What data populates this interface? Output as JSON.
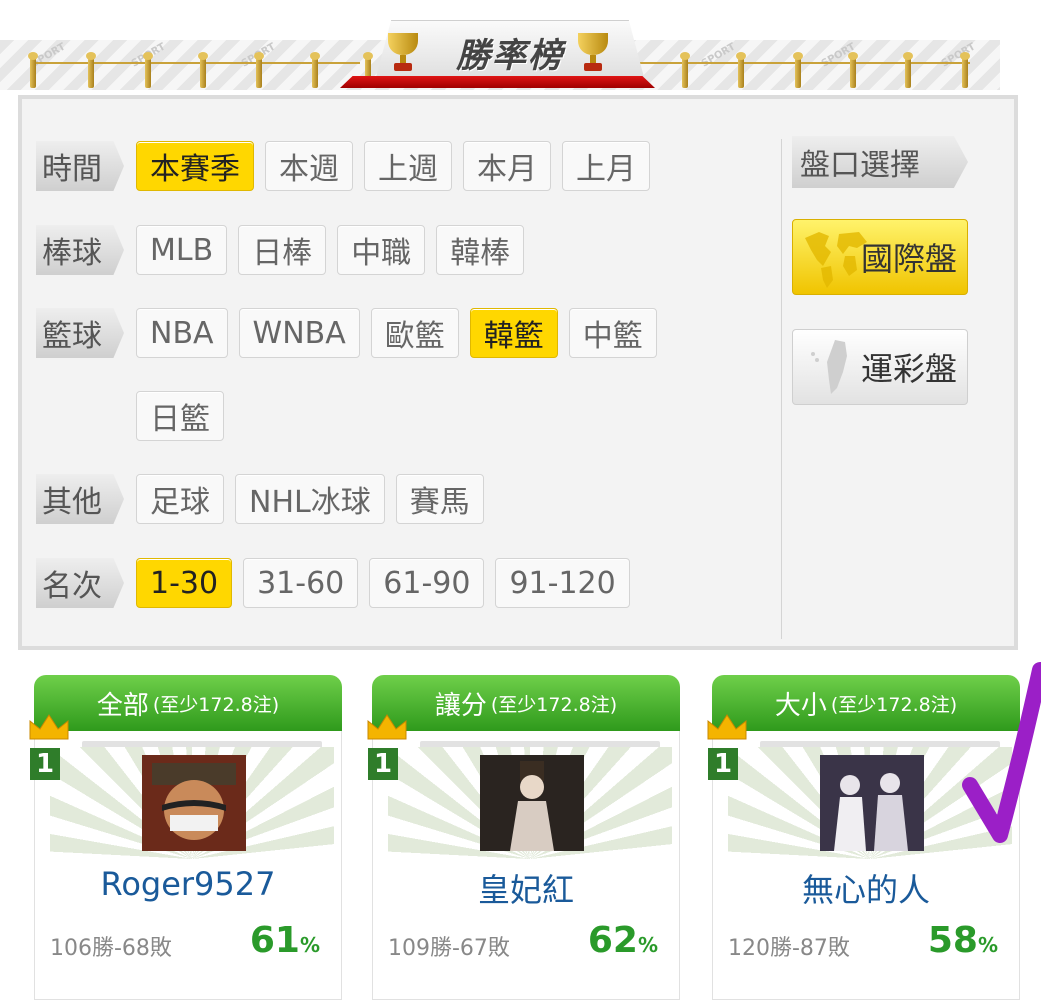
{
  "banner": {
    "title": "勝率榜",
    "watermark": "SPORT"
  },
  "filters": {
    "rows": [
      {
        "label": "時間",
        "options": [
          {
            "text": "本賽季",
            "active": true
          },
          {
            "text": "本週",
            "active": false
          },
          {
            "text": "上週",
            "active": false
          },
          {
            "text": "本月",
            "active": false
          },
          {
            "text": "上月",
            "active": false
          }
        ]
      },
      {
        "label": "棒球",
        "options": [
          {
            "text": "MLB",
            "active": false
          },
          {
            "text": "日棒",
            "active": false
          },
          {
            "text": "中職",
            "active": false
          },
          {
            "text": "韓棒",
            "active": false
          }
        ]
      },
      {
        "label": "籃球",
        "options": [
          {
            "text": "NBA",
            "active": false
          },
          {
            "text": "WNBA",
            "active": false
          },
          {
            "text": "歐籃",
            "active": false
          },
          {
            "text": "韓籃",
            "active": true
          },
          {
            "text": "中籃",
            "active": false
          },
          {
            "text": "日籃",
            "active": false
          }
        ]
      },
      {
        "label": "其他",
        "options": [
          {
            "text": "足球",
            "active": false
          },
          {
            "text": "NHL冰球",
            "active": false
          },
          {
            "text": "賽馬",
            "active": false
          }
        ]
      },
      {
        "label": "名次",
        "options": [
          {
            "text": "1-30",
            "active": true
          },
          {
            "text": "31-60",
            "active": false
          },
          {
            "text": "61-90",
            "active": false
          },
          {
            "text": "91-120",
            "active": false
          }
        ]
      }
    ]
  },
  "market": {
    "label": "盤口選擇",
    "international": "國際盤",
    "taiwan_lottery": "運彩盤",
    "selected": "國際盤"
  },
  "cards": [
    {
      "category": "全部",
      "min_bets": "(至少172.8注)",
      "rank": "1",
      "username": "Roger9527",
      "record": "106勝-68敗",
      "pct": "61",
      "pct_unit": "%"
    },
    {
      "category": "讓分",
      "min_bets": "(至少172.8注)",
      "rank": "1",
      "username": "皇妃紅",
      "record": "109勝-67敗",
      "pct": "62",
      "pct_unit": "%"
    },
    {
      "category": "大小",
      "min_bets": "(至少172.8注)",
      "rank": "1",
      "username": "無心的人",
      "record": "120勝-87敗",
      "pct": "58",
      "pct_unit": "%"
    }
  ],
  "colors": {
    "active": "#ffd700",
    "card_header": "#3fa82a",
    "username": "#1a5a9a",
    "pct": "#2a9a2a",
    "annotation": "#9b1fc7"
  }
}
